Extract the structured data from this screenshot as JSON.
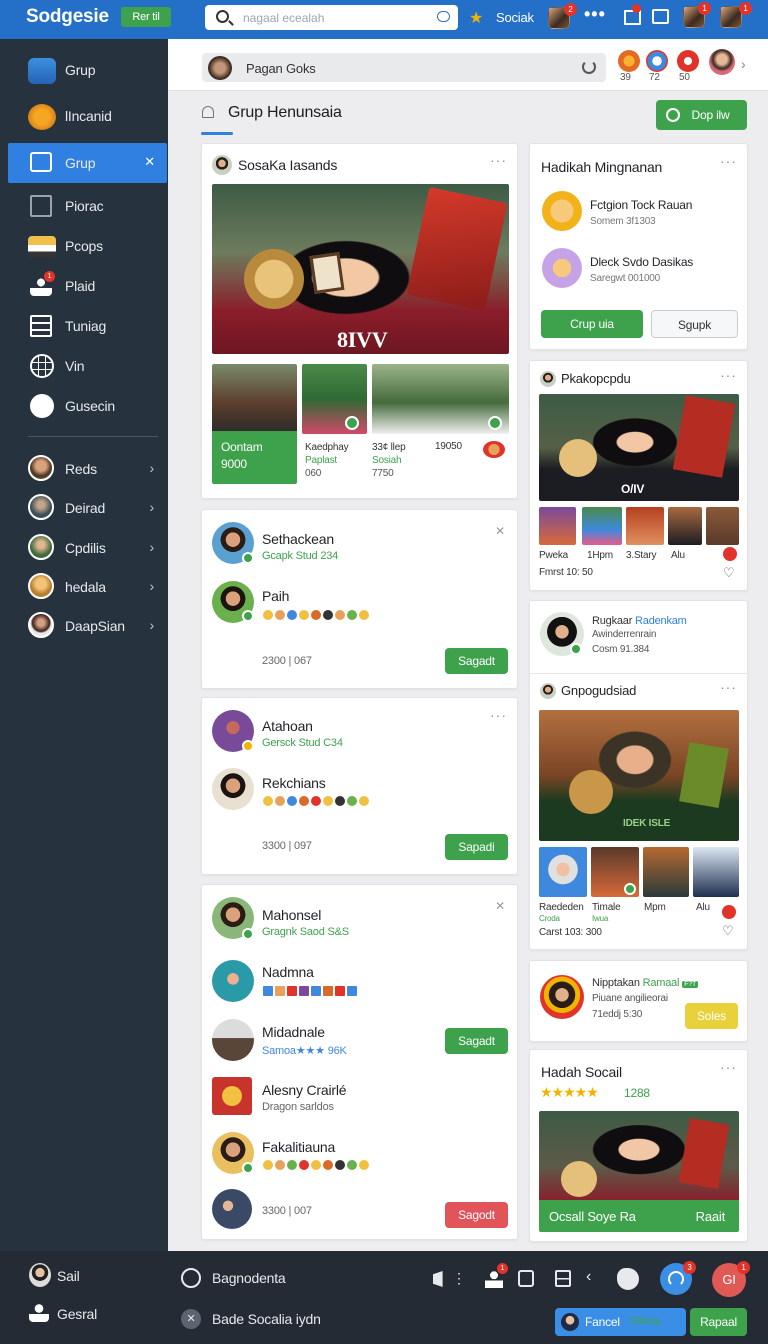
{
  "topbar": {
    "brand": "Sodgesie",
    "brand_pill": "Rer til",
    "search_placeholder": "nagaal ecealah",
    "nav_label": "Sociak",
    "badges": [
      "2",
      "1",
      "1"
    ]
  },
  "sidebar": {
    "items": [
      {
        "label": "Grup",
        "icon": "user-avatar-icon"
      },
      {
        "label": "lIncanid",
        "icon": "sign-icon"
      },
      {
        "label": "Grup",
        "icon": "briefcase-icon",
        "active": true
      },
      {
        "label": "Piorас",
        "icon": "frame-icon"
      },
      {
        "label": "Pcops",
        "icon": "crowd-icon"
      },
      {
        "label": "Plaid",
        "icon": "person-icon",
        "badge": "1"
      },
      {
        "label": "Tuniag",
        "icon": "form-icon"
      },
      {
        "label": "Vin",
        "icon": "globe-icon"
      },
      {
        "label": "Gusecin",
        "icon": "shield-icon"
      }
    ],
    "groups": [
      {
        "label": "Reds"
      },
      {
        "label": "Deirad"
      },
      {
        "label": "Cpdilis"
      },
      {
        "label": "hedala"
      },
      {
        "label": "DaapSian"
      }
    ]
  },
  "subheader": {
    "search_label": "Pagan Goks",
    "counts": [
      "39",
      "72",
      "50"
    ]
  },
  "page": {
    "title": "Grup Henunsaia",
    "action_button": "Dop ilw"
  },
  "feature_post": {
    "author": "SosaKa Iasands",
    "shirt_text": "8IVV",
    "stat_green": {
      "line1": "Oontam",
      "line2": "9000"
    },
    "stats": [
      {
        "line1": "Kaedphay",
        "line2": "Paplast",
        "line3": "060"
      },
      {
        "line1": "33¢ llep",
        "line2": "Sosiah",
        "line3": "7750"
      },
      {
        "line1": "19050",
        "line2": "",
        "line3": ""
      }
    ]
  },
  "member_cards": [
    {
      "members": [
        {
          "name": "Sethackean",
          "sub": "Gcapk Stud 234"
        },
        {
          "name": "Paih",
          "sub": ""
        }
      ],
      "footer": "2300 | 067",
      "button": "Sagadt"
    },
    {
      "members": [
        {
          "name": "Atahoan",
          "sub": "Gersck Stud C34"
        },
        {
          "name": "Rekchians",
          "sub": ""
        }
      ],
      "footer": "3300 | 097",
      "button": "Sapadi"
    },
    {
      "members": [
        {
          "name": "Mahonsel",
          "sub": "Gragnk Saod S&S"
        },
        {
          "name": "Nadmna",
          "sub": ""
        },
        {
          "name": "Midadnale",
          "sub": "Samoa★★★ 96K"
        },
        {
          "name": "Alesny Crairlé",
          "sub": "Dragon sarldos"
        },
        {
          "name": "Fakalitiauna",
          "sub": ""
        }
      ],
      "footer": "3300 | 007",
      "buttons": [
        "Sagadt",
        "Sagodt"
      ]
    }
  ],
  "right_panel": {
    "suggest": {
      "title": "Hadikah Mingnanan",
      "items": [
        {
          "title": "Fctgion Tock Rauan",
          "sub": "Somem 3f1303"
        },
        {
          "title": "Dleck Svdo Dasikas",
          "sub": "Saregwt 001000"
        }
      ],
      "primary": "Crup uia",
      "secondary": "Sgupk"
    },
    "post1": {
      "title": "Pkakopcpdu",
      "shirt_text": "O/IV",
      "captions": [
        "Pweka",
        "1Hpm",
        "3.Stary",
        "Alu"
      ],
      "footer": "Fmrst 10: 50"
    },
    "person1": {
      "line1": "Rugkaar",
      "line1_accent": "Radenkam",
      "line2": "Awinderrenrain",
      "line3": "Cosm 91.384"
    },
    "post2": {
      "title": "Gnpogudsiad",
      "shirt_text": "IDEK ISLE",
      "captions": [
        "Raededen",
        "Timale",
        "Mpm",
        "Alu"
      ],
      "subcaptions": [
        "Croda",
        "Iwua"
      ],
      "footer": "Carst 103: 300"
    },
    "person2": {
      "line1": "Nipptakan",
      "line1_accent": "Ramaal",
      "tag": "F?T",
      "line2": "Piuane angilieorai",
      "line3": "71eddj 5:30",
      "button": "Soles"
    },
    "rating": {
      "title": "Hadah Socail",
      "stars": "★★★★★",
      "count": "1288",
      "banner_left": "Ocsall Soye Ra",
      "banner_right": "Raait"
    }
  },
  "bottombar": {
    "items": [
      {
        "label": "Sail",
        "icon": "avatar-icon"
      },
      {
        "label": "Gesral",
        "icon": "person-icon"
      },
      {
        "label": "Bagnodenta",
        "icon": "chat-icon"
      },
      {
        "label": "Bade Socalia iydn",
        "icon": "close-icon"
      }
    ],
    "badges": [
      "1",
      "3",
      "1"
    ],
    "fab2": "GI",
    "pill_label": "Fancel",
    "pill_accent": "Silsiay",
    "green_btn": "Rapaal"
  }
}
